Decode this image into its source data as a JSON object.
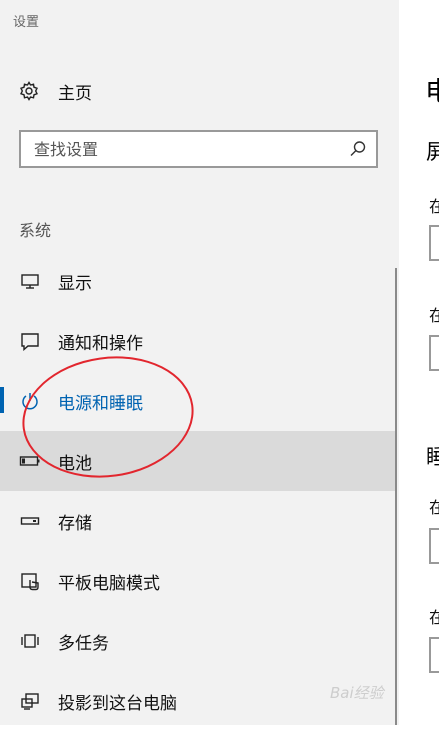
{
  "window": {
    "title": "设置"
  },
  "sidebar": {
    "home_label": "主页",
    "search_placeholder": "查找设置",
    "section_header": "系统",
    "items": [
      {
        "label": "显示",
        "icon": "monitor-icon"
      },
      {
        "label": "通知和操作",
        "icon": "notification-icon"
      },
      {
        "label": "电源和睡眠",
        "icon": "power-icon",
        "selected": true
      },
      {
        "label": "电池",
        "icon": "battery-icon",
        "hovered": true
      },
      {
        "label": "存储",
        "icon": "storage-icon"
      },
      {
        "label": "平板电脑模式",
        "icon": "tablet-mode-icon"
      },
      {
        "label": "多任务",
        "icon": "multitasking-icon"
      },
      {
        "label": "投影到这台电脑",
        "icon": "projecting-icon"
      }
    ]
  },
  "content": {
    "title": "电",
    "heading_1": "屏",
    "text_1": "在",
    "text_2": "在",
    "heading_2": "睡",
    "text_3": "在",
    "text_4": "在"
  },
  "watermark": {
    "text": "Bai经验"
  },
  "colors": {
    "accent": "#0063b1",
    "sidebar_bg": "#f2f2f2",
    "hover_bg": "#dadada",
    "annotation": "#e2262e"
  }
}
